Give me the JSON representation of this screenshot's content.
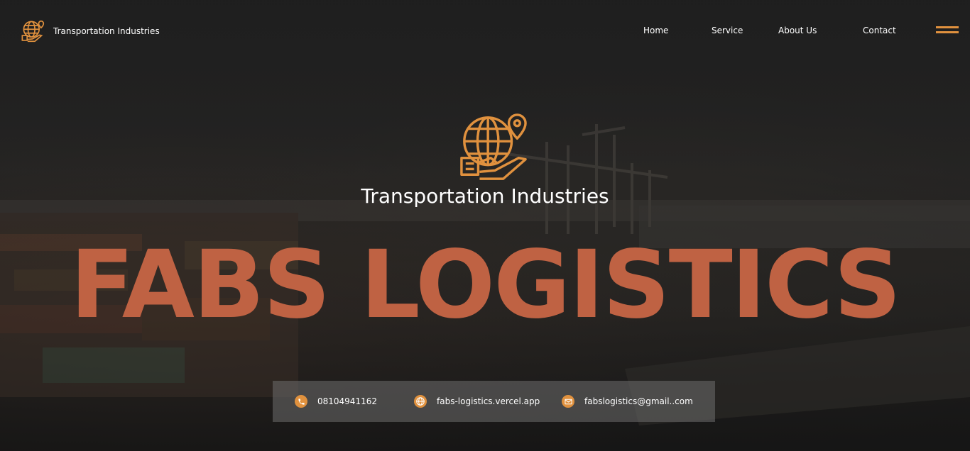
{
  "colors": {
    "accent": "#e0913e",
    "title": "#bf6243",
    "text": "#ffffff",
    "background": "#1e1e1e"
  },
  "nav": {
    "brand": "Transportation Industries",
    "links": [
      "Home",
      "Service",
      "About Us",
      "Contact"
    ],
    "menu_icon": "hamburger-icon"
  },
  "hero": {
    "logo_icon": "globe-delivery-icon",
    "subtitle": "Transportation Industries",
    "title": "FABS LOGISTICS"
  },
  "contacts": [
    {
      "icon": "phone-icon",
      "text": "08104941162"
    },
    {
      "icon": "globe-icon",
      "text": "fabs-logistics.vercel.app"
    },
    {
      "icon": "mail-icon",
      "text": "fabslogistics@gmail..com"
    }
  ]
}
